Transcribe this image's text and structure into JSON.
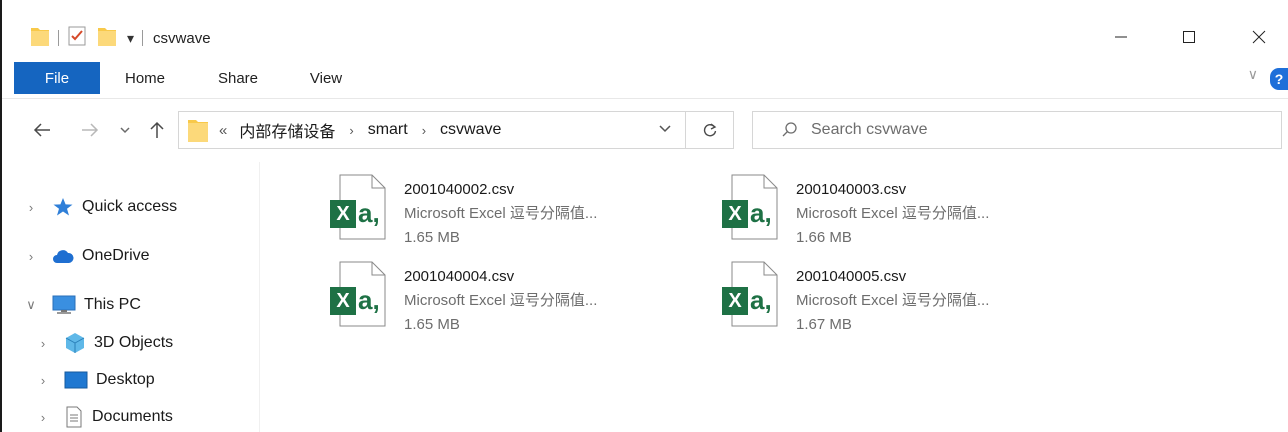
{
  "window": {
    "title": "csvwave",
    "qat_dropdown": "▾"
  },
  "ribbon": {
    "tabs": [
      "File",
      "Home",
      "Share",
      "View"
    ],
    "toggle": "∨",
    "help": "?"
  },
  "address": {
    "overflow": "«",
    "crumbs": [
      "内部存储设备",
      "smart",
      "csvwave"
    ],
    "separator": "›"
  },
  "search": {
    "placeholder": "Search csvwave"
  },
  "navpane": {
    "items": [
      {
        "label": "Quick access",
        "chevron": "›",
        "icon": "star-icon"
      },
      {
        "label": "OneDrive",
        "chevron": "›",
        "icon": "cloud-icon"
      },
      {
        "label": "This PC",
        "chevron": "∨",
        "icon": "monitor-icon"
      },
      {
        "label": "3D Objects",
        "chevron": "›",
        "icon": "cube-icon"
      },
      {
        "label": "Desktop",
        "chevron": "›",
        "icon": "desktop-icon"
      },
      {
        "label": "Documents",
        "chevron": "›",
        "icon": "document-icon"
      }
    ]
  },
  "files": [
    {
      "name": "2001040002.csv",
      "type": "Microsoft Excel 逗号分隔值...",
      "size": "1.65 MB"
    },
    {
      "name": "2001040003.csv",
      "type": "Microsoft Excel 逗号分隔值...",
      "size": "1.66 MB"
    },
    {
      "name": "2001040004.csv",
      "type": "Microsoft Excel 逗号分隔值...",
      "size": "1.65 MB"
    },
    {
      "name": "2001040005.csv",
      "type": "Microsoft Excel 逗号分隔值...",
      "size": "1.67 MB"
    }
  ],
  "icon_badge": {
    "x": "X",
    "a": "a,"
  },
  "colors": {
    "accent": "#1565c0",
    "excel_green": "#1e7145",
    "folder_yellow": "#f8c94a"
  }
}
